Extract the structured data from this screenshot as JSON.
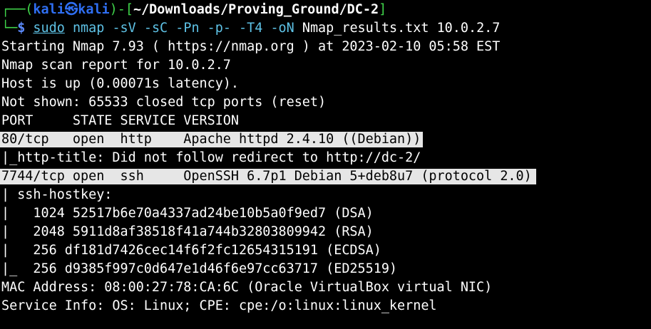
{
  "prompt": {
    "box_top": "┌──(",
    "user": "kali",
    "at_symbol": "㉿",
    "host": "kali",
    "sep": ")-[",
    "path": "~/Downloads/Proving_Ground/DC-2",
    "close": "]",
    "box_bottom": "└─",
    "dollar": "$",
    "sudo": "sudo",
    "command": "nmap -sV -sC -Pn -p- -T4 -oN",
    "args": "Nmap_results.txt 10.0.2.7"
  },
  "output": {
    "line1": "Starting Nmap 7.93 ( https://nmap.org ) at 2023-02-10 05:58 EST",
    "line2": "Nmap scan report for 10.0.2.7",
    "line3": "Host is up (0.00071s latency).",
    "line4": "Not shown: 65533 closed tcp ports (reset)",
    "header": "PORT     STATE SERVICE VERSION",
    "port80": "80/tcp   open  http    Apache httpd 2.4.10 ((Debian))",
    "http_title": "|_http-title: Did not follow redirect to http://dc-2/",
    "port7744": "7744/tcp open  ssh     OpenSSH 6.7p1 Debian 5+deb8u7 (protocol 2.0)",
    "ssh_hostkey": "| ssh-hostkey:",
    "key_dsa": "|   1024 52517b6e70a4337ad24be10b5a0f9ed7 (DSA)",
    "key_rsa": "|   2048 5911d8af38518f41a744b32803809942 (RSA)",
    "key_ecdsa": "|   256 df181d7426cec14f6f2fc12654315191 (ECDSA)",
    "key_ed25519": "|_  256 d9385f997c0d647e1d46f6e97cc63717 (ED25519)",
    "mac": "MAC Address: 08:00:27:78:CA:6C (Oracle VirtualBox virtual NIC)",
    "service_info": "Service Info: OS: Linux; CPE: cpe:/o:linux:linux_kernel"
  },
  "colors": {
    "background": "#000000",
    "prompt_blue": "#2f6ff3",
    "prompt_green": "#3fd44a",
    "command_cyan": "#5ec2e6",
    "highlight_bg": "#e6e6e6"
  }
}
